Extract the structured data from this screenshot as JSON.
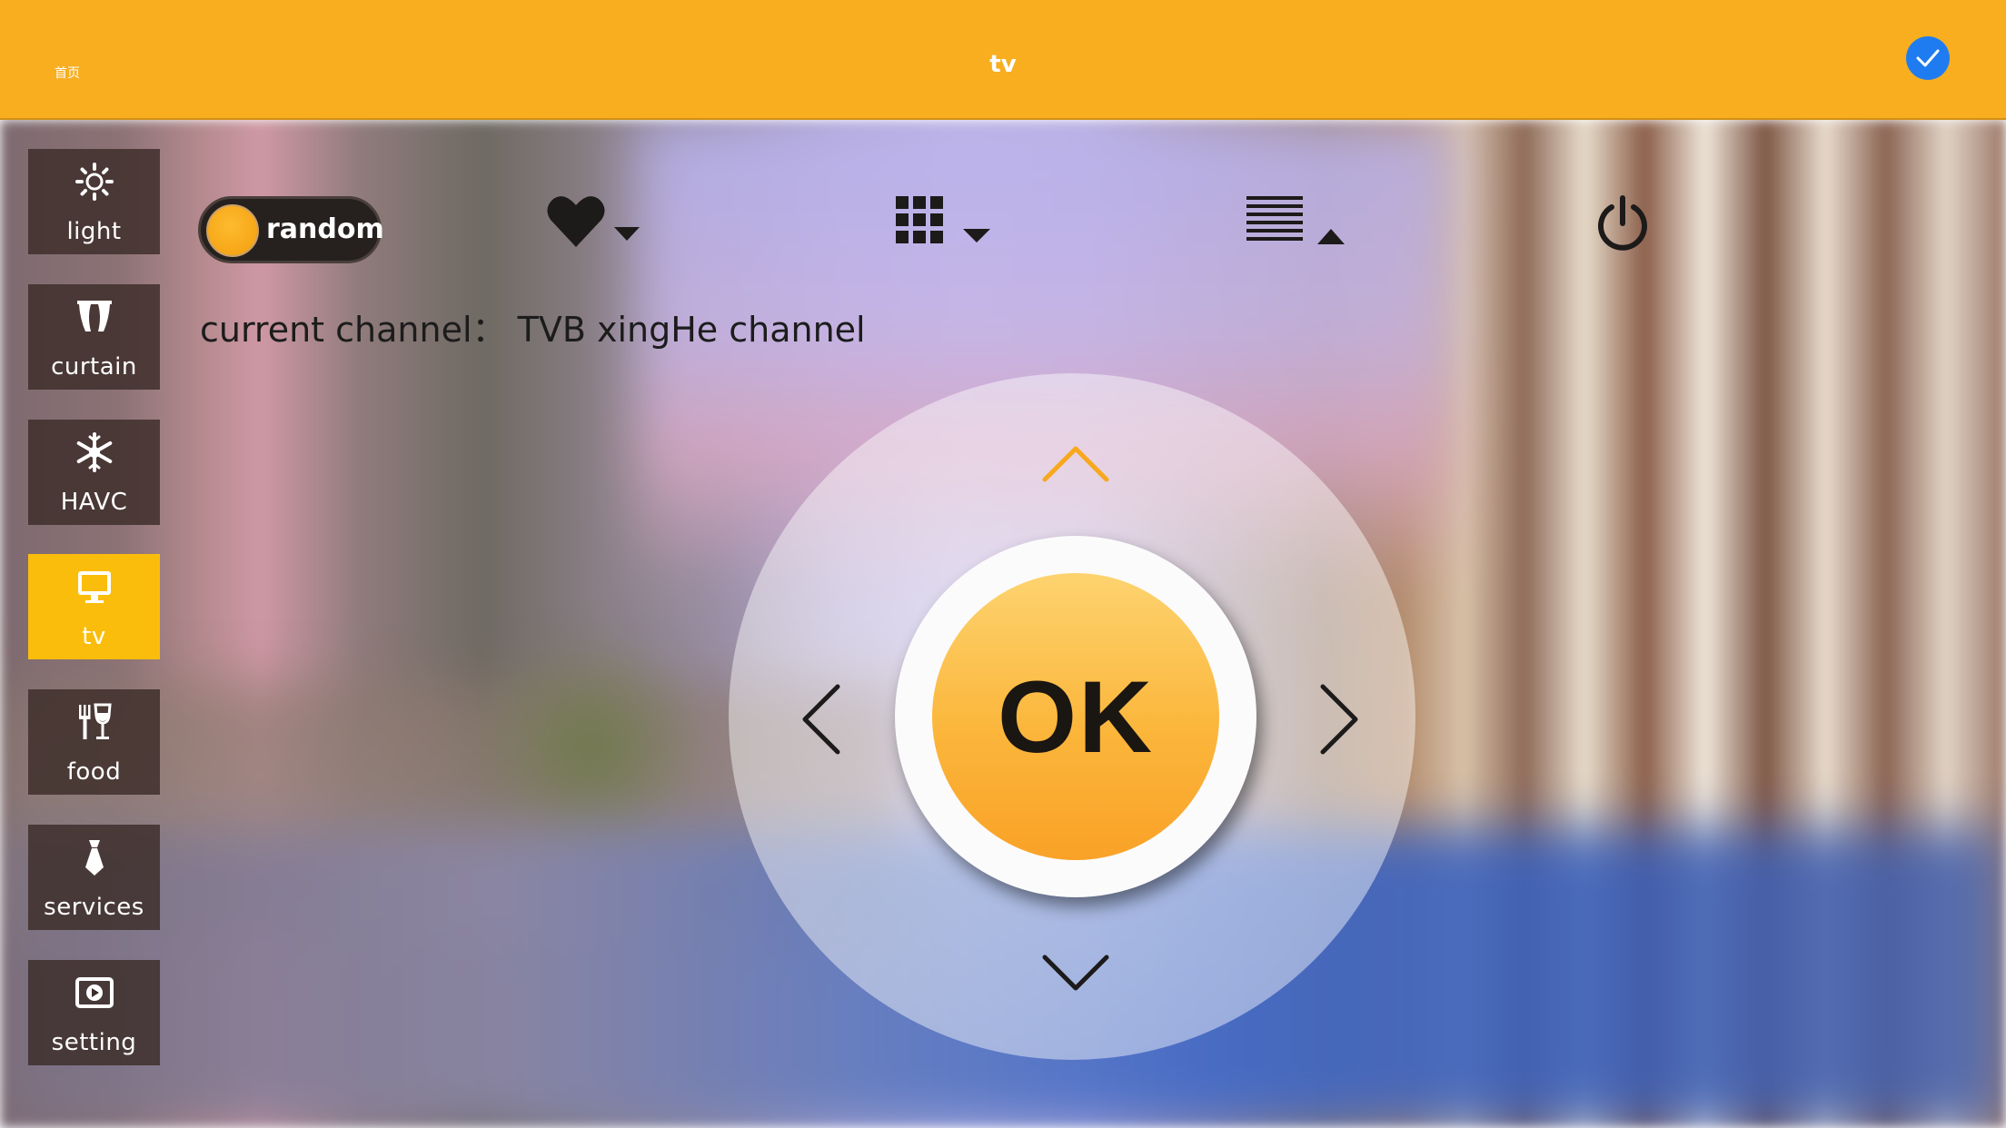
{
  "header": {
    "home_label": "首页",
    "title": "tv",
    "bg_color": "#f8ae1f",
    "confirm_icon": "check-icon"
  },
  "sidebar": {
    "items": [
      {
        "label": "light",
        "icon": "sun-icon",
        "active": false
      },
      {
        "label": "curtain",
        "icon": "curtain-icon",
        "active": false
      },
      {
        "label": "HAVC",
        "icon": "snowflake-icon",
        "active": false
      },
      {
        "label": "tv",
        "icon": "monitor-icon",
        "active": true
      },
      {
        "label": "food",
        "icon": "fork-wine-icon",
        "active": false
      },
      {
        "label": "services",
        "icon": "tie-icon",
        "active": false
      },
      {
        "label": "setting",
        "icon": "settings-icon",
        "active": false
      }
    ],
    "active_color": "#fbbd0b"
  },
  "controls": {
    "random_label": "random",
    "favorite_icon": "heart-dropdown-icon",
    "grid_icon": "grid-dropdown-icon",
    "list_icon": "list-dropup-icon",
    "power_icon": "power-icon"
  },
  "channel": {
    "text": "current channel：  TVB xingHe channel"
  },
  "dpad": {
    "ok_label": "OK",
    "up_icon": "chevron-up-icon",
    "down_icon": "chevron-down-icon",
    "left_icon": "chevron-left-icon",
    "right_icon": "chevron-right-icon",
    "ok_color": "#fbb63b"
  }
}
